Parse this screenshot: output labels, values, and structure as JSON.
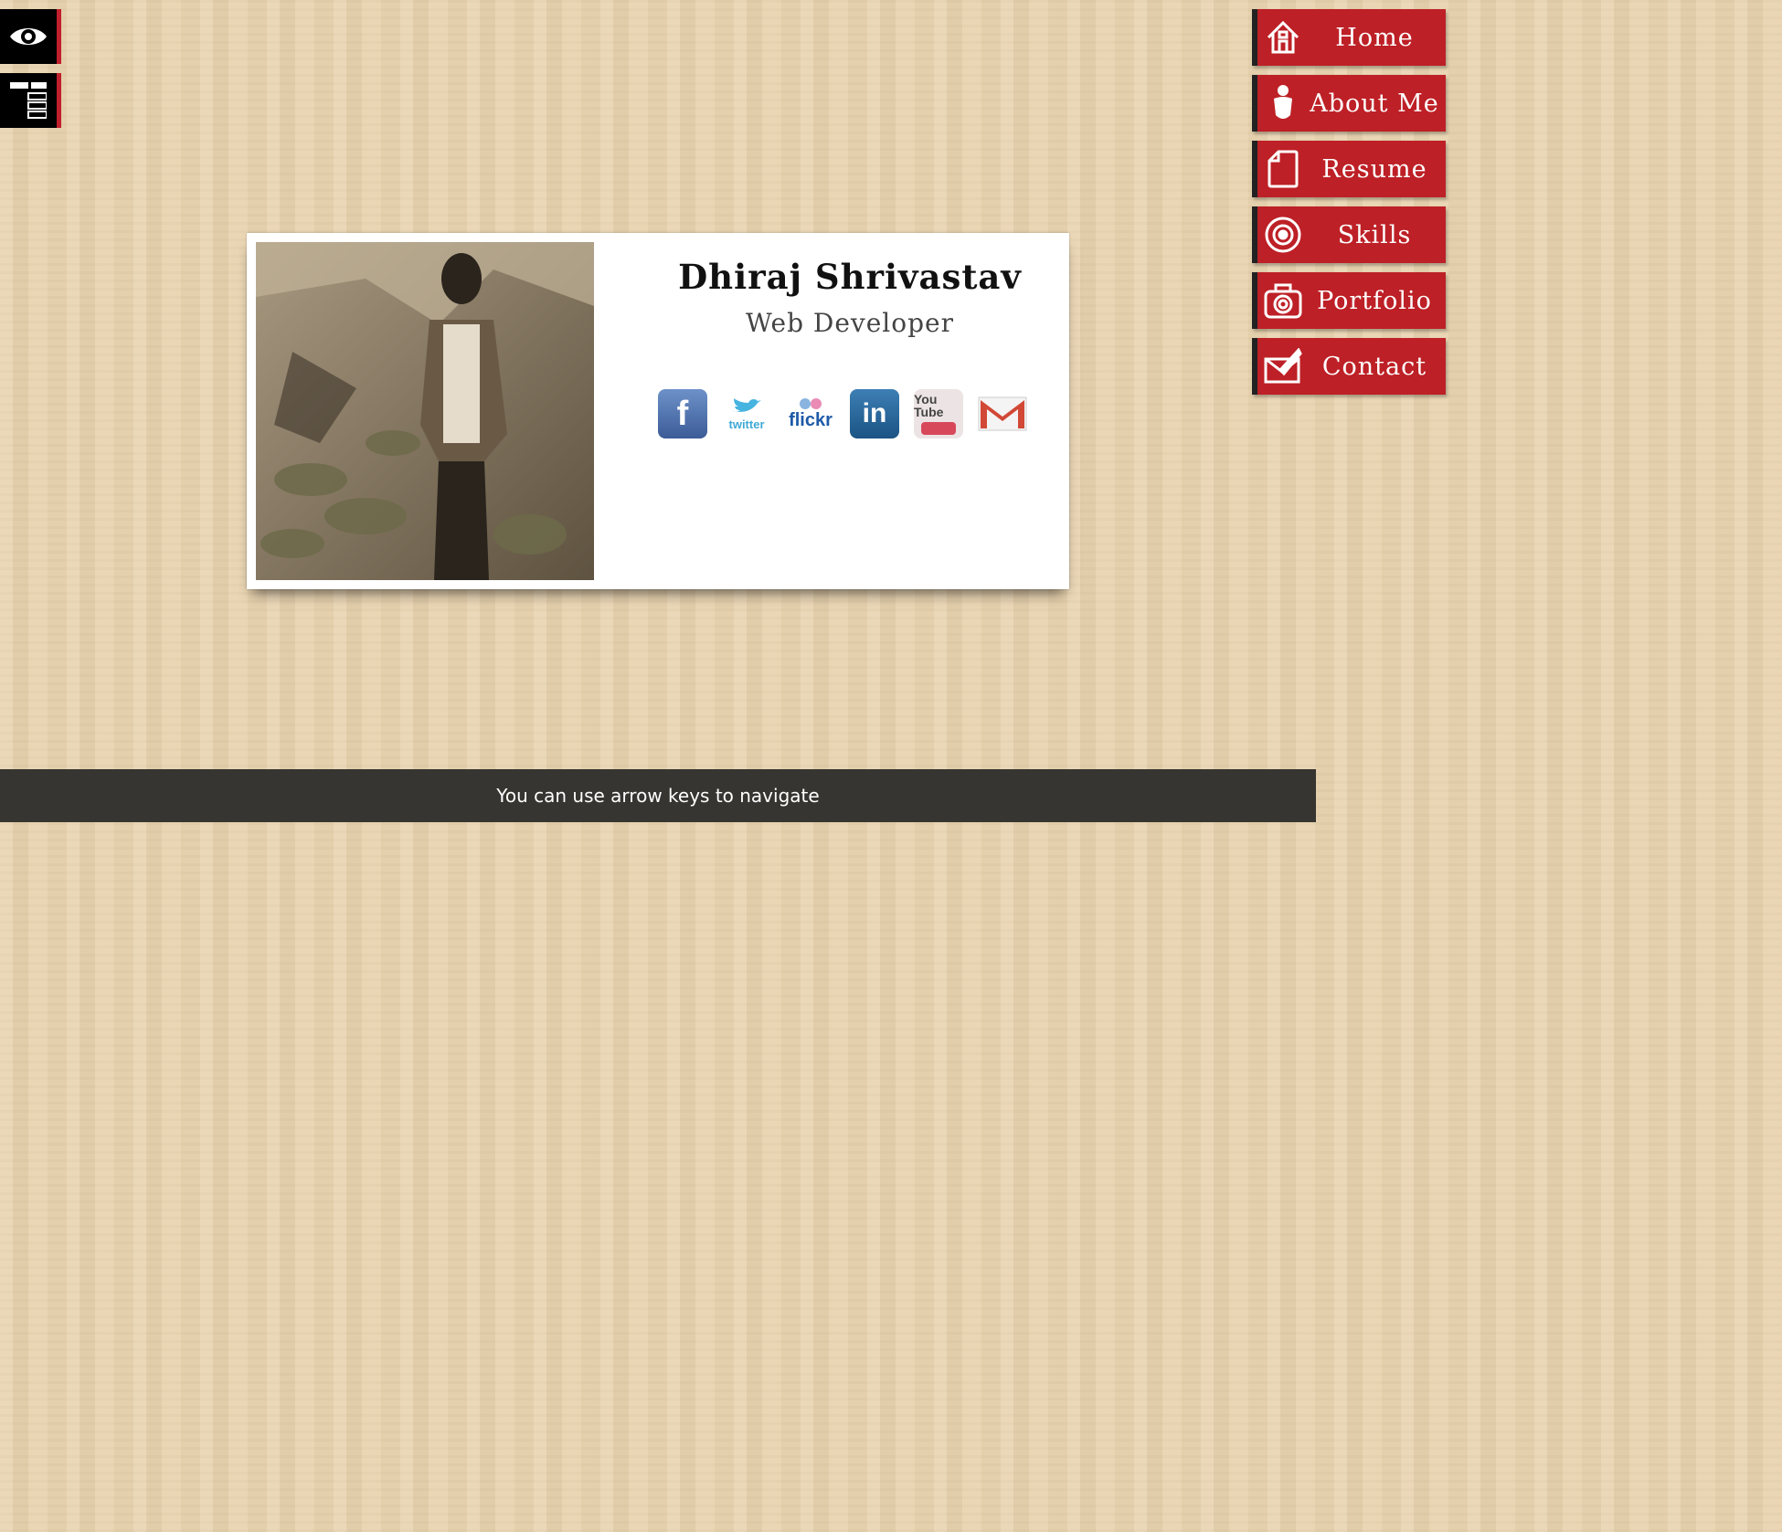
{
  "tools": [
    {
      "icon": "eye-icon"
    },
    {
      "icon": "layout-icon"
    }
  ],
  "profile": {
    "name": "Dhiraj Shrivastav",
    "title": "Web Developer",
    "social": [
      {
        "icon": "facebook-icon",
        "text": "f"
      },
      {
        "icon": "twitter-icon",
        "text": "twitter"
      },
      {
        "icon": "flickr-icon",
        "text": "flickr"
      },
      {
        "icon": "linkedin-icon",
        "text": "in"
      },
      {
        "icon": "youtube-icon",
        "text": "You Tube"
      },
      {
        "icon": "gmail-icon",
        "text": "M"
      }
    ]
  },
  "nav": [
    {
      "label": "Home",
      "icon": "home-icon"
    },
    {
      "label": "About Me",
      "icon": "person-icon"
    },
    {
      "label": "Resume",
      "icon": "document-icon"
    },
    {
      "label": "Skills",
      "icon": "target-icon"
    },
    {
      "label": "Portfolio",
      "icon": "camera-icon"
    },
    {
      "label": "Contact",
      "icon": "mail-icon"
    }
  ],
  "hint": "You can use arrow keys to navigate",
  "colors": {
    "accent": "#bd2026",
    "hint_bar": "#363531",
    "background": "#e9d3ae"
  }
}
